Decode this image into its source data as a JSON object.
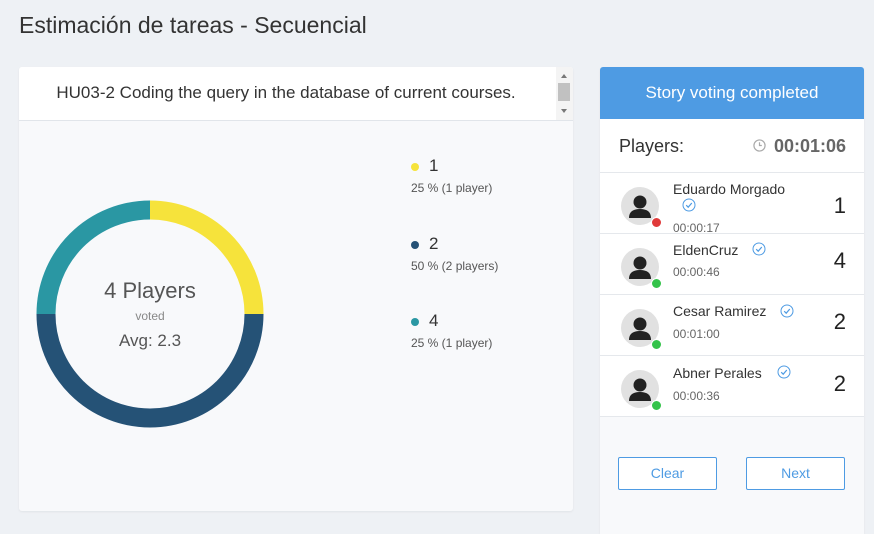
{
  "page": {
    "title": "Estimación de tareas - Secuencial"
  },
  "story": {
    "text": "HU03-2 Coding the query in the database of current courses."
  },
  "results": {
    "players_count_label": "4 Players",
    "voted_label": "voted",
    "avg_label": "Avg: 2.3"
  },
  "chart_data": {
    "type": "pie",
    "donut": true,
    "slices": [
      {
        "label": "1",
        "value": 25,
        "detail": "25 % (1 player)",
        "color": "#f6e33b"
      },
      {
        "label": "2",
        "value": 50,
        "detail": "50 % (2 players)",
        "color": "#255276"
      },
      {
        "label": "4",
        "value": 25,
        "detail": "25 % (1 player)",
        "color": "#2a97a3"
      }
    ]
  },
  "panel": {
    "status": "Story voting completed",
    "players_label": "Players:",
    "timer": "00:01:06",
    "players": [
      {
        "name": "Eduardo Morgado",
        "time": "00:00:17",
        "vote": "1",
        "status_color": "#e03a3a"
      },
      {
        "name": "EldenCruz",
        "time": "00:00:46",
        "vote": "4",
        "status_color": "#34c34a"
      },
      {
        "name": "Cesar Ramirez",
        "time": "00:01:00",
        "vote": "2",
        "status_color": "#34c34a"
      },
      {
        "name": "Abner Perales",
        "time": "00:00:36",
        "vote": "2",
        "status_color": "#34c34a"
      }
    ],
    "clear_label": "Clear",
    "next_label": "Next"
  },
  "colors": {
    "accent": "#4e9be3"
  }
}
